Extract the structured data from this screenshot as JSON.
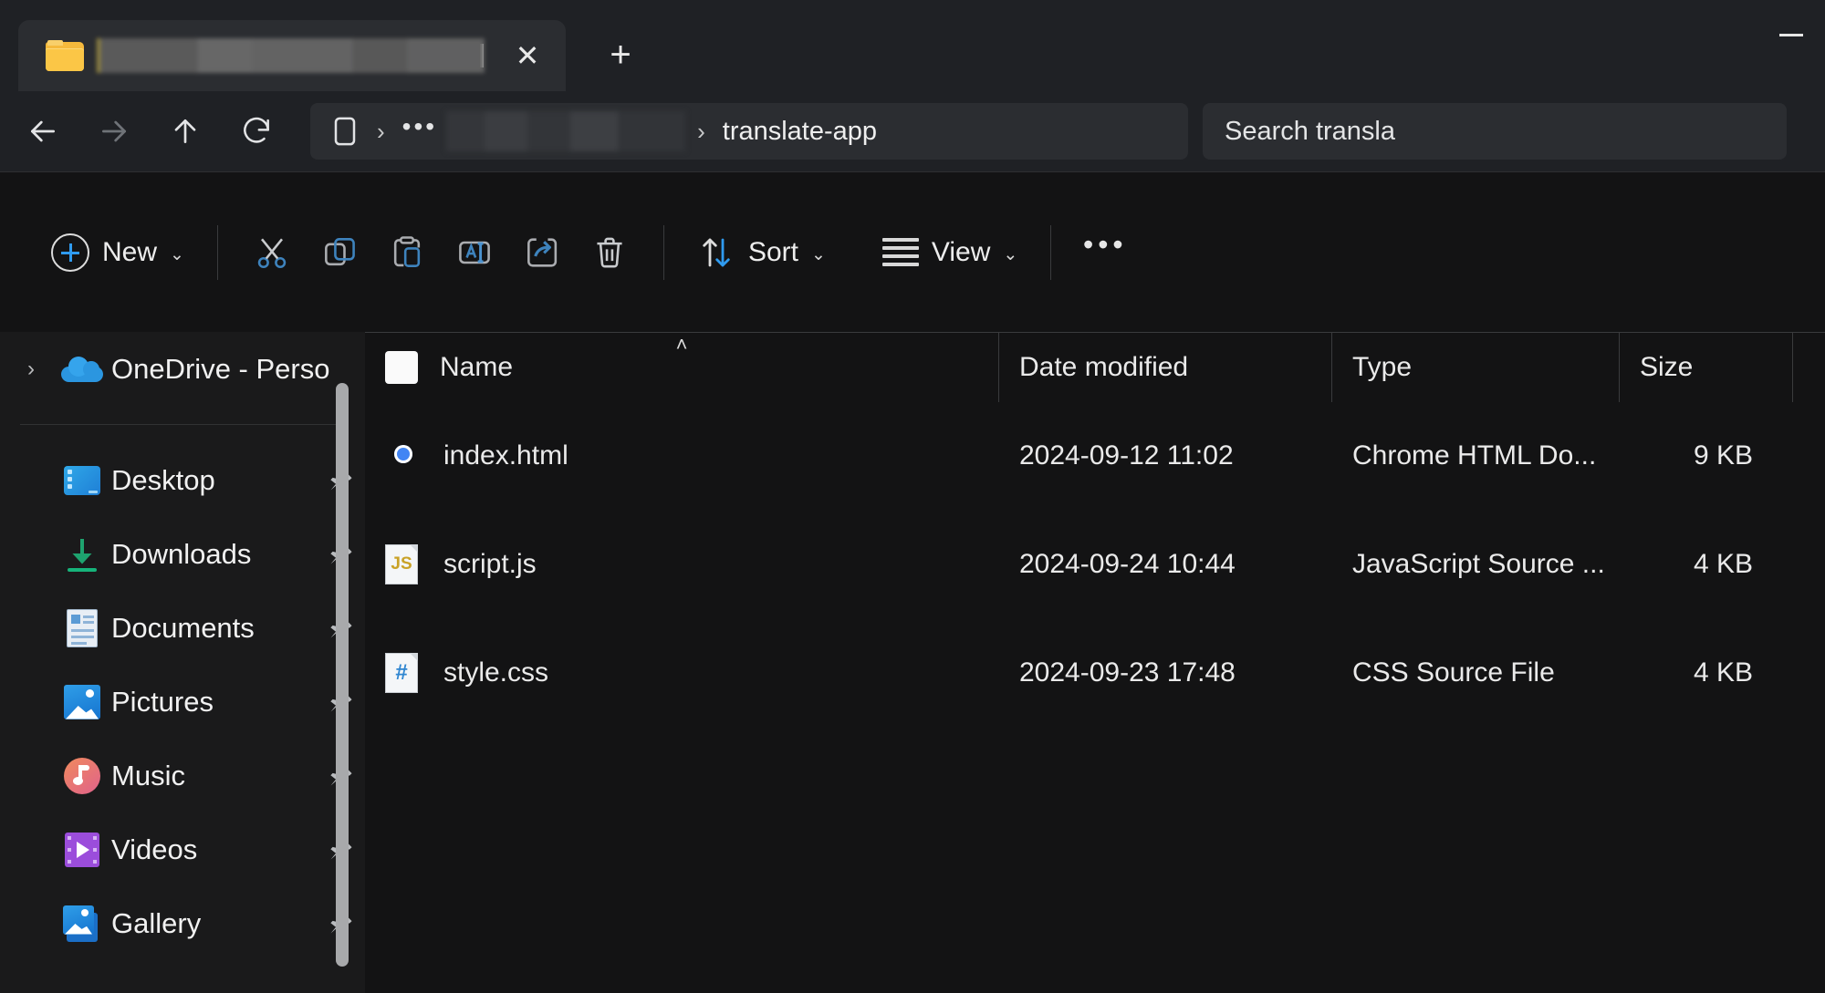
{
  "window": {
    "titlebar": {
      "folder_icon": "folder-icon",
      "tab_title": "",
      "tab_title_redacted": true,
      "close_label": "✕",
      "new_tab_label": "+",
      "minimize_label": "—"
    },
    "address_bar": {
      "back_label": "back-arrow-icon",
      "forward_label": "forward-arrow-icon",
      "up_label": "up-arrow-icon",
      "refresh_label": "refresh-icon",
      "breadcrumb": {
        "root_icon": "this-pc-icon",
        "separator": "›",
        "ellipsis": "•••",
        "redacted_segment": "",
        "current": "translate-app"
      },
      "search": {
        "placeholder": "Search transla",
        "value": ""
      }
    },
    "command_bar": {
      "new_label": "New",
      "new_chevron": "⌄",
      "cut_label": "cut-icon",
      "copy_label": "copy-icon",
      "paste_label": "paste-icon",
      "rename_label": "rename-icon",
      "share_label": "share-icon",
      "delete_label": "delete-icon",
      "sort_label": "Sort",
      "sort_chevron": "⌄",
      "view_label": "View",
      "view_chevron": "⌄",
      "more_label": "•••"
    }
  },
  "nav_pane": {
    "items": [
      {
        "label": "OneDrive - Perso",
        "icon": "onedrive-cloud-icon",
        "expander": "›",
        "pinned": false,
        "indented": false
      },
      {
        "label": "Desktop",
        "icon": "desktop-icon",
        "expander": "",
        "pinned": true,
        "indented": true
      },
      {
        "label": "Downloads",
        "icon": "downloads-icon",
        "expander": "",
        "pinned": true,
        "indented": true
      },
      {
        "label": "Documents",
        "icon": "documents-icon",
        "expander": "",
        "pinned": true,
        "indented": true
      },
      {
        "label": "Pictures",
        "icon": "pictures-icon",
        "expander": "",
        "pinned": true,
        "indented": true
      },
      {
        "label": "Music",
        "icon": "music-icon",
        "expander": "",
        "pinned": true,
        "indented": true
      },
      {
        "label": "Videos",
        "icon": "videos-icon",
        "expander": "",
        "pinned": true,
        "indented": true
      },
      {
        "label": "Gallery",
        "icon": "gallery-icon",
        "expander": "",
        "pinned": true,
        "indented": true
      }
    ],
    "scrollbar_visible": true
  },
  "file_list": {
    "columns": [
      {
        "key": "name",
        "label": "Name",
        "sorted": "asc",
        "sort_caret": "˄"
      },
      {
        "key": "date",
        "label": "Date modified",
        "sorted": "",
        "sort_caret": ""
      },
      {
        "key": "type",
        "label": "Type",
        "sorted": "",
        "sort_caret": ""
      },
      {
        "key": "size",
        "label": "Size",
        "sorted": "",
        "sort_caret": ""
      }
    ],
    "select_all_checked": false,
    "rows": [
      {
        "name": "index.html",
        "icon": "chrome-html-document-icon",
        "icon_kind": "chrome",
        "icon_text": "",
        "date": "2024-09-12 11:02",
        "type": "Chrome HTML Do...",
        "size": "9 KB"
      },
      {
        "name": "script.js",
        "icon": "javascript-file-icon",
        "icon_kind": "js",
        "icon_text": "JS",
        "date": "2024-09-24 10:44",
        "type": "JavaScript Source ...",
        "size": "4 KB"
      },
      {
        "name": "style.css",
        "icon": "css-file-icon",
        "icon_kind": "css",
        "icon_text": "#",
        "date": "2024-09-23 17:48",
        "type": "CSS Source File",
        "size": "4 KB"
      }
    ]
  },
  "colors": {
    "window_chrome": "#1f2125",
    "tab_active": "#2b2d31",
    "content_bg": "#131314",
    "nav_bg": "#1a1a1b",
    "accent_blue": "#2f9bf0",
    "text_primary": "#eaeaea",
    "divider": "#3a3b3d"
  }
}
